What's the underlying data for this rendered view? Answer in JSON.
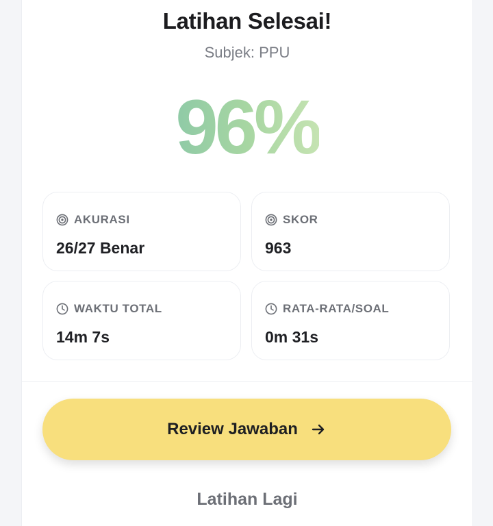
{
  "header": {
    "title": "Latihan Selesai!",
    "subject": "Subjek: PPU"
  },
  "result": {
    "percentage": "96%"
  },
  "stats": [
    {
      "label": "AKURASI",
      "value": "26/27 Benar",
      "icon": "target-icon"
    },
    {
      "label": "SKOR",
      "value": "963",
      "icon": "target-icon"
    },
    {
      "label": "WAKTU TOTAL",
      "value": "14m 7s",
      "icon": "clock-icon"
    },
    {
      "label": "RATA-RATA/SOAL",
      "value": "0m 31s",
      "icon": "clock-icon"
    }
  ],
  "actions": {
    "review_label": "Review Jawaban",
    "review_icon": "arrow-right-icon",
    "again_label": "Latihan Lagi"
  },
  "colors": {
    "accent_button": "#f8df7d",
    "score_gradient_start": "#8fcaa6",
    "score_gradient_end": "#c5e3b2"
  }
}
